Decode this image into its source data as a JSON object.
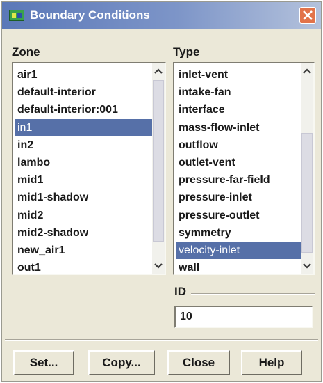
{
  "dialog": {
    "title": "Boundary Conditions"
  },
  "zone": {
    "label": "Zone",
    "items": [
      "air1",
      "default-interior",
      "default-interior:001",
      "in1",
      "in2",
      "lambo",
      "mid1",
      "mid1-shadow",
      "mid2",
      "mid2-shadow",
      "new_air1",
      "out1"
    ],
    "selected": "in1"
  },
  "type": {
    "label": "Type",
    "items": [
      "inlet-vent",
      "intake-fan",
      "interface",
      "mass-flow-inlet",
      "outflow",
      "outlet-vent",
      "pressure-far-field",
      "pressure-inlet",
      "pressure-outlet",
      "symmetry",
      "velocity-inlet",
      "wall"
    ],
    "selected": "velocity-inlet"
  },
  "id": {
    "label": "ID",
    "value": "10"
  },
  "buttons": {
    "set": "Set...",
    "copy": "Copy...",
    "close": "Close",
    "help": "Help"
  },
  "colors": {
    "title_bar": "#5b78b8",
    "selection": "#5670a8",
    "dialog_bg": "#ebe8d8",
    "close_button": "#e2734a"
  },
  "icons": {
    "app": "app-icon",
    "close": "close-icon",
    "scroll_up": "chevron-up-icon",
    "scroll_down": "chevron-down-icon"
  }
}
